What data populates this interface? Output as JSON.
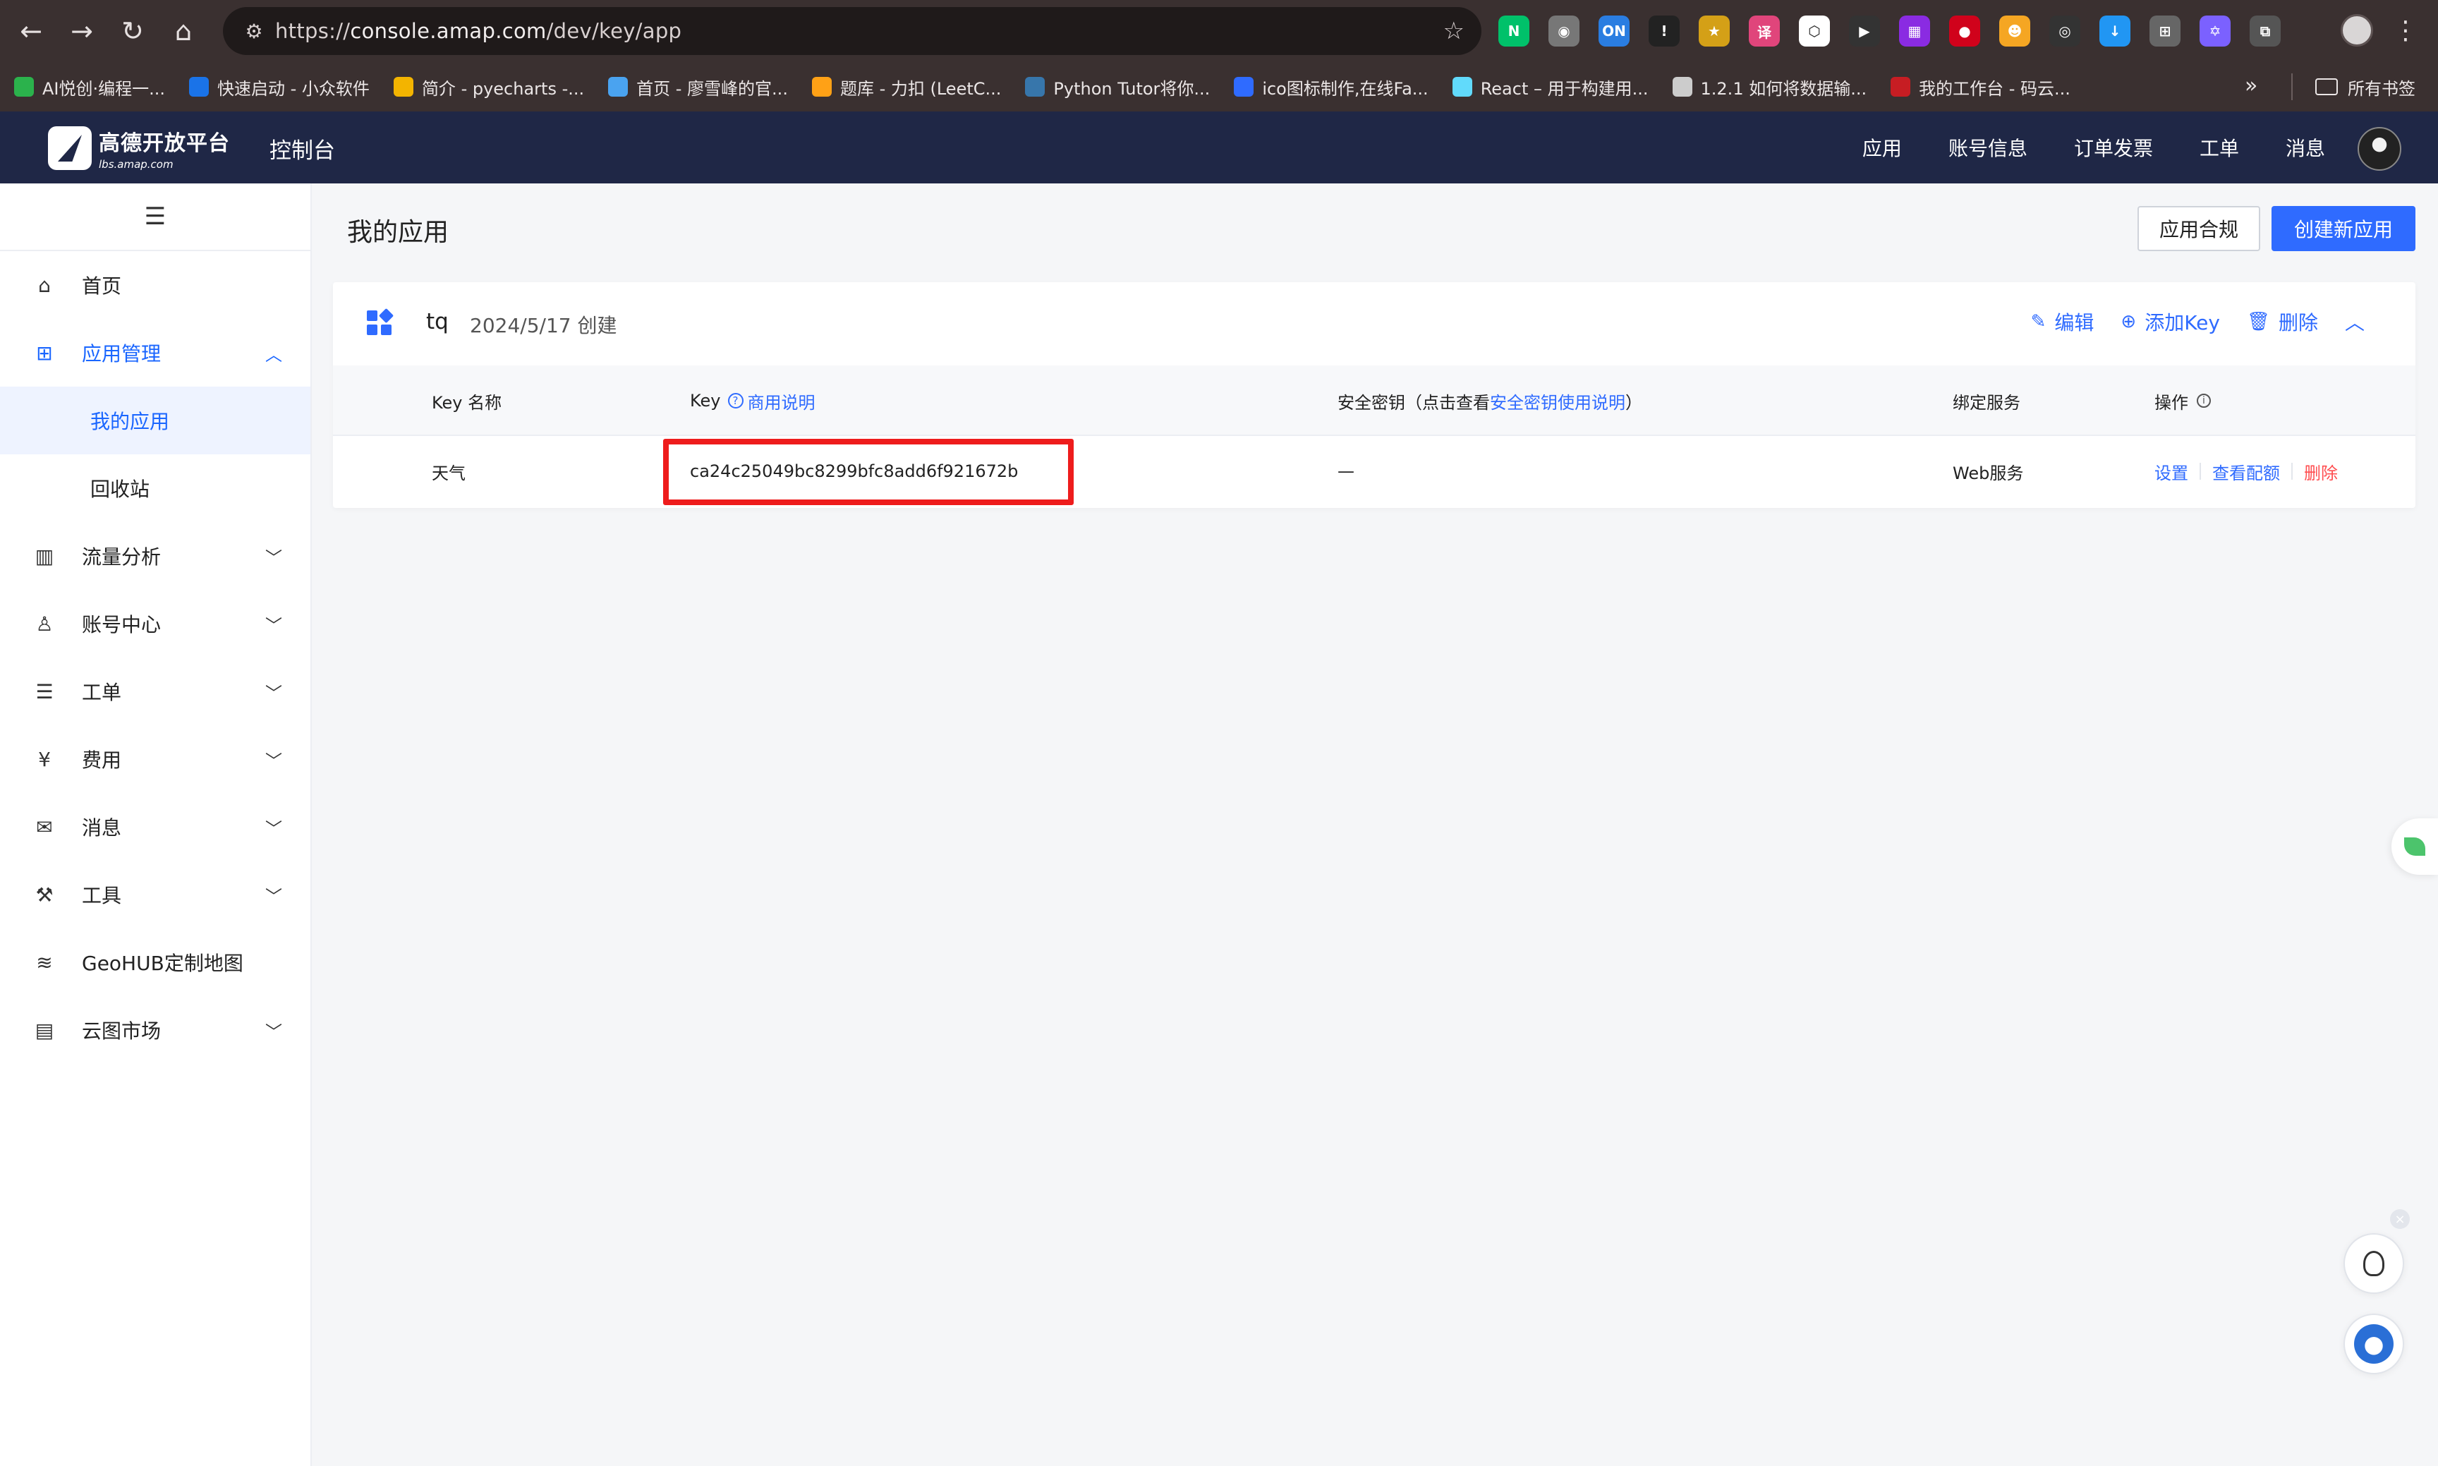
{
  "browser": {
    "url_prefix": "https://",
    "url_host": "console.amap.com",
    "url_path": "/dev/key/app",
    "bookmarks": [
      {
        "label": "AI悦创·编程一...",
        "color": "#2bb24c"
      },
      {
        "label": "快速启动 - 小众软件",
        "color": "#1a73e8"
      },
      {
        "label": "简介 - pyecharts -...",
        "color": "#f3b400"
      },
      {
        "label": "首页 - 廖雪峰的官...",
        "color": "#4aa3f0"
      },
      {
        "label": "题库 - 力扣 (LeetC...",
        "color": "#ffa116"
      },
      {
        "label": "Python Tutor将你...",
        "color": "#3776ab"
      },
      {
        "label": "ico图标制作,在线Fa...",
        "color": "#2f6bff"
      },
      {
        "label": "React – 用于构建用...",
        "color": "#61dafb"
      },
      {
        "label": "1.2.1 如何将数据输...",
        "color": "#cccccc"
      },
      {
        "label": "我的工作台 - 码云...",
        "color": "#c71d23"
      }
    ],
    "bookmarks_folder": "所有书签",
    "extensions": [
      {
        "name": "nuxt-icon",
        "color": "#00c16a",
        "glyph": "N"
      },
      {
        "name": "camera-icon",
        "color": "#777777",
        "glyph": "◉"
      },
      {
        "name": "on-toggle-icon",
        "color": "#2a7de1",
        "glyph": "ON"
      },
      {
        "name": "badge-icon",
        "color": "#222222",
        "glyph": "!"
      },
      {
        "name": "star-icon",
        "color": "#d4a017",
        "glyph": "★"
      },
      {
        "name": "translate-icon",
        "color": "#e0457b",
        "glyph": "译"
      },
      {
        "name": "hex-icon",
        "color": "#ffffff",
        "glyph": "⬡"
      },
      {
        "name": "cursor-icon",
        "color": "#333333",
        "glyph": "▶"
      },
      {
        "name": "tetris-icon",
        "color": "#8a2be2",
        "glyph": "▦"
      },
      {
        "name": "record-icon",
        "color": "#d0021b",
        "glyph": "●"
      },
      {
        "name": "monkey-icon",
        "color": "#f5a623",
        "glyph": "☻"
      },
      {
        "name": "github-icon",
        "color": "#333333",
        "glyph": "◎"
      },
      {
        "name": "download-icon",
        "color": "#2196f3",
        "glyph": "↓"
      },
      {
        "name": "grid-icon",
        "color": "#666666",
        "glyph": "⊞"
      },
      {
        "name": "react-icon",
        "color": "#7b61ff",
        "glyph": "✡"
      },
      {
        "name": "puzzle-icon",
        "color": "#555555",
        "glyph": "⧉"
      }
    ]
  },
  "header": {
    "brand": "高德开放平台",
    "domain": "lbs.amap.com",
    "console": "控制台",
    "nav": [
      "应用",
      "账号信息",
      "订单发票",
      "工单",
      "消息"
    ]
  },
  "sidebar": {
    "items": [
      {
        "label": "首页",
        "icon": "home-icon",
        "glyph": "⌂"
      },
      {
        "label": "应用管理",
        "icon": "apps-icon",
        "glyph": "⊞"
      },
      {
        "label": "我的应用"
      },
      {
        "label": "回收站"
      },
      {
        "label": "流量分析",
        "icon": "chart-icon",
        "glyph": "▥"
      },
      {
        "label": "账号中心",
        "icon": "user-icon",
        "glyph": "♙"
      },
      {
        "label": "工单",
        "icon": "ticket-icon",
        "glyph": "☰"
      },
      {
        "label": "费用",
        "icon": "bill-icon",
        "glyph": "¥"
      },
      {
        "label": "消息",
        "icon": "message-icon",
        "glyph": "✉"
      },
      {
        "label": "工具",
        "icon": "wrench-icon",
        "glyph": "⚒"
      },
      {
        "label": "GeoHUB定制地图",
        "icon": "layers-icon",
        "glyph": "≋"
      },
      {
        "label": "云图市场",
        "icon": "store-icon",
        "glyph": "▤"
      }
    ]
  },
  "main": {
    "title": "我的应用",
    "btn_compliance": "应用合规",
    "btn_create": "创建新应用",
    "app": {
      "name": "tq",
      "created": "2024/5/17 创建",
      "actions": {
        "edit": "编辑",
        "add_key": "添加Key",
        "delete": "删除"
      }
    },
    "table": {
      "headers": {
        "key_name": "Key 名称",
        "key": "Key",
        "key_link": "商用说明",
        "secret_prefix": "安全密钥（点击查看",
        "secret_link": "安全密钥使用说明",
        "secret_suffix": "）",
        "service": "绑定服务",
        "ops": "操作"
      },
      "rows": [
        {
          "key_name": "天气",
          "key": "ca24c25049bc8299bfc8add6f921672b",
          "secret": "—",
          "service": "Web服务",
          "op_settings": "设置",
          "op_quota": "查看配额",
          "op_delete": "删除"
        }
      ]
    }
  },
  "colors": {
    "accent": "#2f6bff",
    "header_bg": "#1f2746",
    "danger": "#ff4d4f",
    "highlight": "#ee1c1c"
  }
}
